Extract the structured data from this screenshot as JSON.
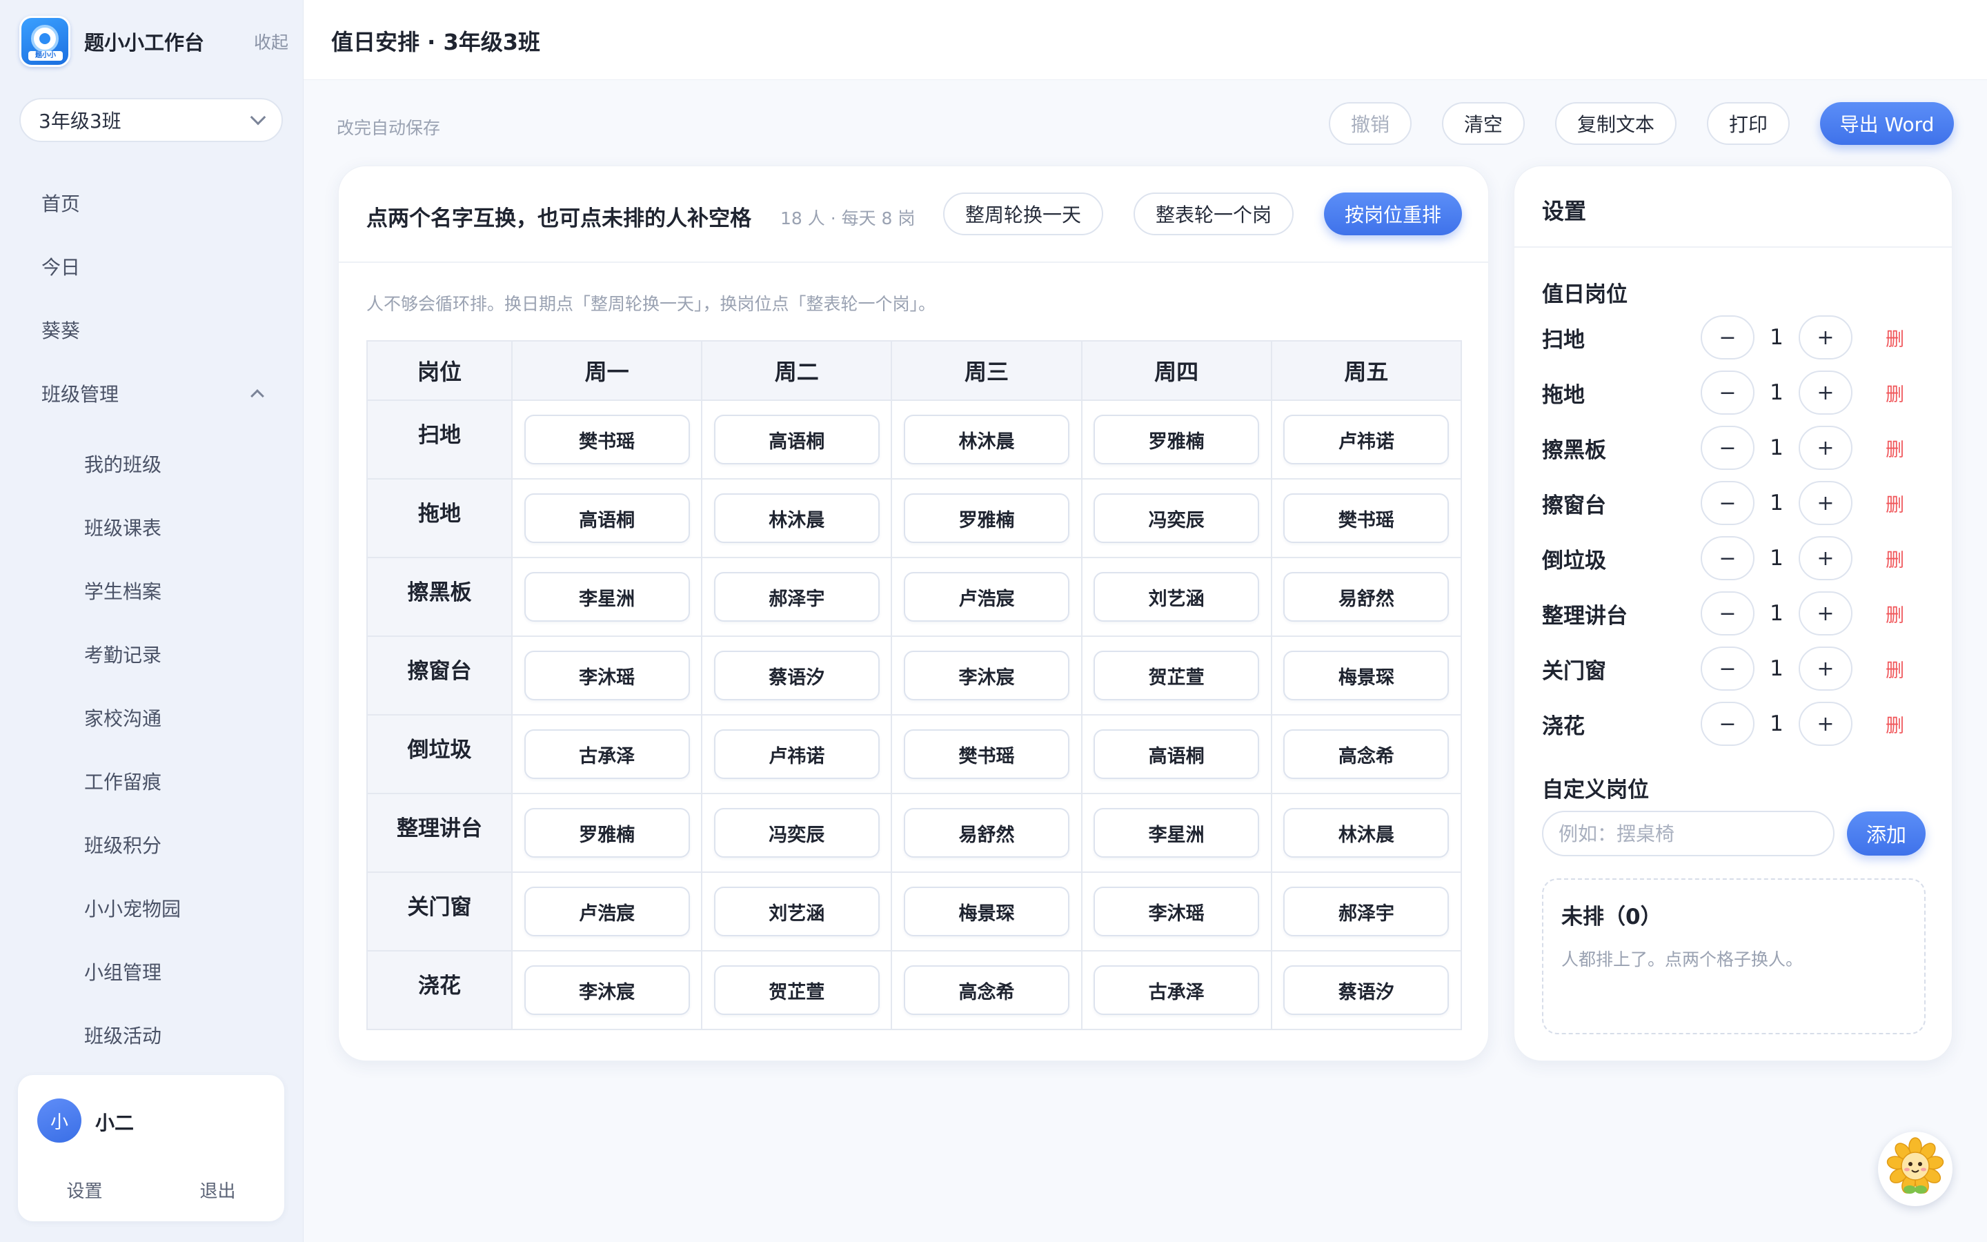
{
  "app": {
    "name": "题小小工作台",
    "logo_tag": "题小小",
    "collapse_label": "收起"
  },
  "class_selector": {
    "value": "3年级3班"
  },
  "nav": {
    "home": "首页",
    "today": "今日",
    "kuikui": "葵葵",
    "class_mgmt": "班级管理",
    "sub": [
      "我的班级",
      "班级课表",
      "学生档案",
      "考勤记录",
      "家校沟通",
      "工作留痕",
      "班级积分",
      "小小宠物园",
      "小组管理",
      "班级活动"
    ]
  },
  "user": {
    "avatar_text": "小",
    "name": "小二",
    "settings_label": "设置",
    "logout_label": "退出"
  },
  "header": {
    "title": "值日安排 · 3年级3班"
  },
  "toolbar": {
    "autosave": "改完自动保存",
    "undo": "撤销",
    "clear": "清空",
    "copy_text": "复制文本",
    "print": "打印",
    "export_word": "导出 Word"
  },
  "schedule": {
    "title": "点两个名字互换，也可点未排的人补空格",
    "meta": "18 人 · 每天 8 岗",
    "btn_rotate_day": "整周轮换一天",
    "btn_rotate_role": "整表轮一个岗",
    "btn_rearrange": "按岗位重排",
    "hint": "人不够会循环排。换日期点「整周轮换一天」，换岗位点「整表轮一个岗」。",
    "columns": [
      "岗位",
      "周一",
      "周二",
      "周三",
      "周四",
      "周五"
    ],
    "rows": [
      {
        "role": "扫地",
        "names": [
          "樊书瑶",
          "高语桐",
          "林沐晨",
          "罗雅楠",
          "卢祎诺"
        ]
      },
      {
        "role": "拖地",
        "names": [
          "高语桐",
          "林沐晨",
          "罗雅楠",
          "冯奕辰",
          "樊书瑶"
        ]
      },
      {
        "role": "擦黑板",
        "names": [
          "李星洲",
          "郝泽宇",
          "卢浩宸",
          "刘艺涵",
          "易舒然"
        ]
      },
      {
        "role": "擦窗台",
        "names": [
          "李沐瑶",
          "蔡语汐",
          "李沐宸",
          "贺芷萱",
          "梅景琛"
        ]
      },
      {
        "role": "倒垃圾",
        "names": [
          "古承泽",
          "卢祎诺",
          "樊书瑶",
          "高语桐",
          "高念希"
        ]
      },
      {
        "role": "整理讲台",
        "names": [
          "罗雅楠",
          "冯奕辰",
          "易舒然",
          "李星洲",
          "林沐晨"
        ]
      },
      {
        "role": "关门窗",
        "names": [
          "卢浩宸",
          "刘艺涵",
          "梅景琛",
          "李沐瑶",
          "郝泽宇"
        ]
      },
      {
        "role": "浇花",
        "names": [
          "李沐宸",
          "贺芷萱",
          "高念希",
          "古承泽",
          "蔡语汐"
        ]
      }
    ]
  },
  "settings": {
    "title": "设置",
    "roles_title": "值日岗位",
    "minus": "−",
    "plus": "+",
    "delete_label": "删",
    "roles": [
      {
        "name": "扫地",
        "count": "1"
      },
      {
        "name": "拖地",
        "count": "1"
      },
      {
        "name": "擦黑板",
        "count": "1"
      },
      {
        "name": "擦窗台",
        "count": "1"
      },
      {
        "name": "倒垃圾",
        "count": "1"
      },
      {
        "name": "整理讲台",
        "count": "1"
      },
      {
        "name": "关门窗",
        "count": "1"
      },
      {
        "name": "浇花",
        "count": "1"
      }
    ],
    "custom_title": "自定义岗位",
    "custom_placeholder": "例如：摆桌椅",
    "custom_value": "",
    "add_label": "添加",
    "unassigned_title": "未排（0）",
    "unassigned_note": "人都排上了。点两个格子换人。"
  },
  "mascot": {
    "icon": "sunflower-mascot-icon"
  }
}
